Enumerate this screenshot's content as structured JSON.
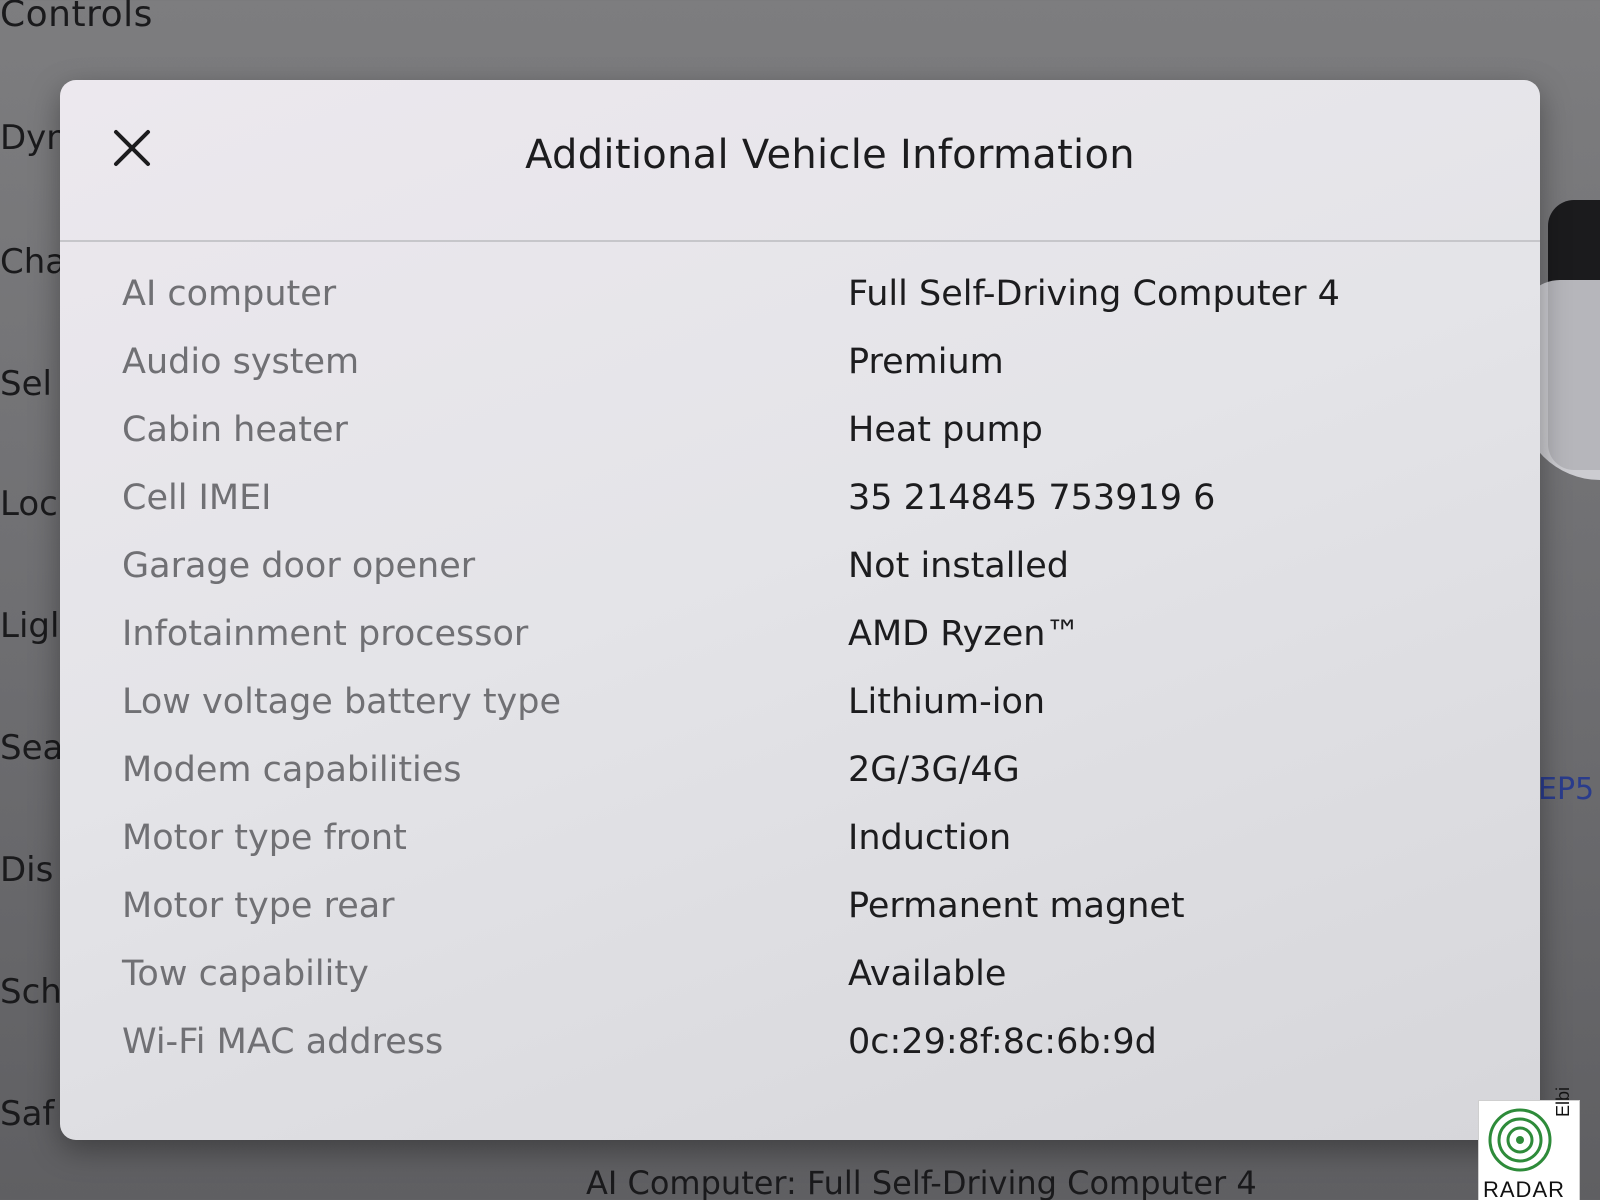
{
  "background": {
    "title": "Controls",
    "sidebar_items": [
      "Dyn",
      "Cha",
      "Sel",
      "Loc",
      "Ligl",
      "Sea",
      "Dis",
      "Sch",
      "Saf"
    ],
    "right_link": "EP5",
    "bottom_text": "AI Computer: Full Self-Driving Computer 4"
  },
  "modal": {
    "title": "Additional Vehicle Information",
    "close_icon": "close-icon",
    "rows": [
      {
        "label": "AI computer",
        "value": "Full Self-Driving Computer 4"
      },
      {
        "label": "Audio system",
        "value": "Premium"
      },
      {
        "label": "Cabin heater",
        "value": "Heat pump"
      },
      {
        "label": "Cell IMEI",
        "value": "35 214845 753919 6"
      },
      {
        "label": "Garage door opener",
        "value": "Not installed"
      },
      {
        "label": "Infotainment processor",
        "value": "AMD Ryzen™"
      },
      {
        "label": "Low voltage battery type",
        "value": "Lithium-ion"
      },
      {
        "label": "Modem capabilities",
        "value": "2G/3G/4G"
      },
      {
        "label": "Motor type front",
        "value": "Induction"
      },
      {
        "label": "Motor type rear",
        "value": "Permanent magnet"
      },
      {
        "label": "Tow capability",
        "value": "Available"
      },
      {
        "label": "Wi-Fi MAC address",
        "value": "0c:29:8f:8c:6b:9d"
      }
    ]
  },
  "watermark": {
    "text": "RADAR",
    "side_text": "Elbi"
  },
  "colors": {
    "modal_background": "#e4e4e8",
    "label_text": "#707074",
    "value_text": "#1c1c1e"
  }
}
